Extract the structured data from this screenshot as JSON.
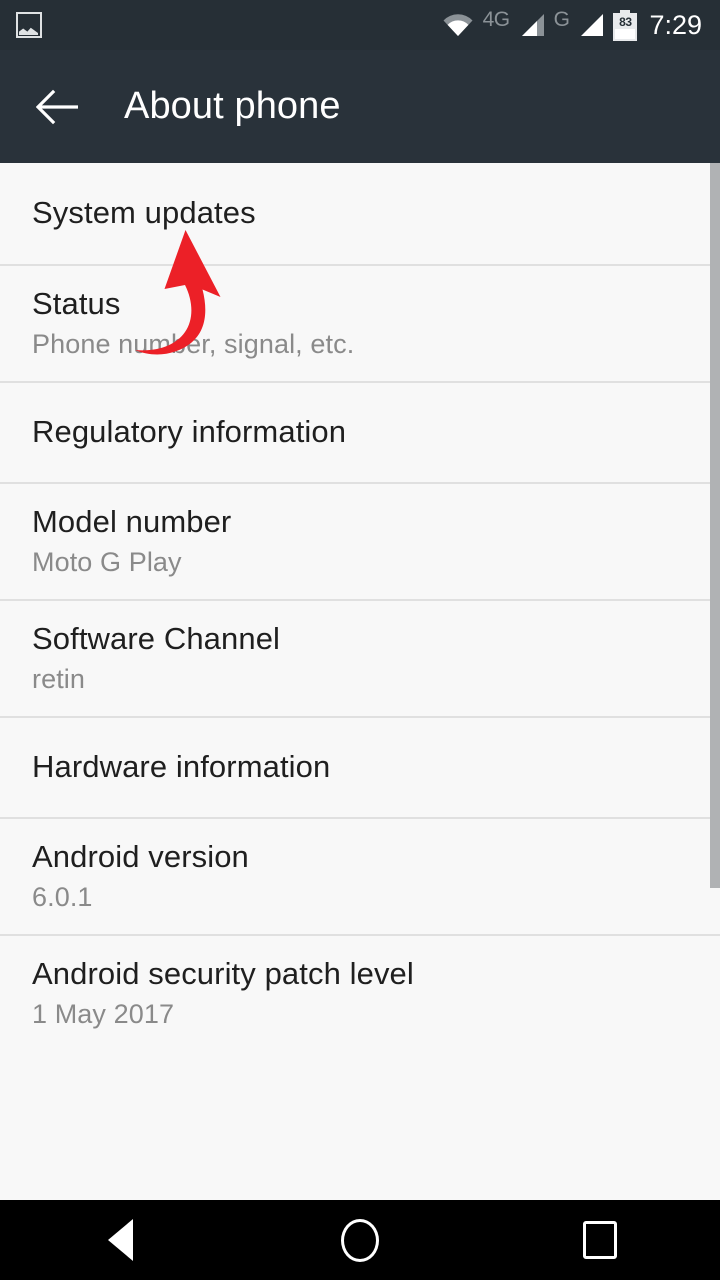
{
  "status_bar": {
    "left_icons": [
      {
        "name": "screenshot-image-icon",
        "glyph": "picture"
      }
    ],
    "wifi_icon": "wifi-icon",
    "network_labels": [
      "4G",
      "G"
    ],
    "signal_icons": [
      "signal-bars-partial-icon",
      "signal-bars-full-icon"
    ],
    "battery": {
      "icon": "battery-icon",
      "level": "83"
    },
    "time": "7:29",
    "background_color": "#262f36"
  },
  "action_bar": {
    "back_icon": "back-arrow-icon",
    "title": "About phone",
    "background_color": "#29323a",
    "text_color": "#ffffff"
  },
  "list": {
    "items": [
      {
        "title": "System updates",
        "subtitle": ""
      },
      {
        "title": "Status",
        "subtitle": "Phone number, signal, etc."
      },
      {
        "title": "Regulatory information",
        "subtitle": ""
      },
      {
        "title": "Model number",
        "subtitle": "Moto G Play"
      },
      {
        "title": "Software Channel",
        "subtitle": "retin"
      },
      {
        "title": "Hardware information",
        "subtitle": ""
      },
      {
        "title": "Android version",
        "subtitle": "6.0.1"
      },
      {
        "title": "Android security patch level",
        "subtitle": "1 May 2017"
      }
    ],
    "title_color": "#1f1f1f",
    "subtitle_color": "#8a8a8a",
    "background_color": "#f8f8f8",
    "divider_color": "#e0e0e0"
  },
  "scrollbar": {
    "name": "vertical-scrollbar",
    "thumb_color": "#b0b2b4"
  },
  "annotation": {
    "name": "red-curved-arrow",
    "points_to": "System updates",
    "color": "#ec2027"
  },
  "nav_bar": {
    "background_color": "#000000",
    "buttons": [
      {
        "name": "nav-back-button",
        "icon": "triangle-back-icon"
      },
      {
        "name": "nav-home-button",
        "icon": "circle-home-icon"
      },
      {
        "name": "nav-recents-button",
        "icon": "square-recents-icon"
      }
    ]
  }
}
